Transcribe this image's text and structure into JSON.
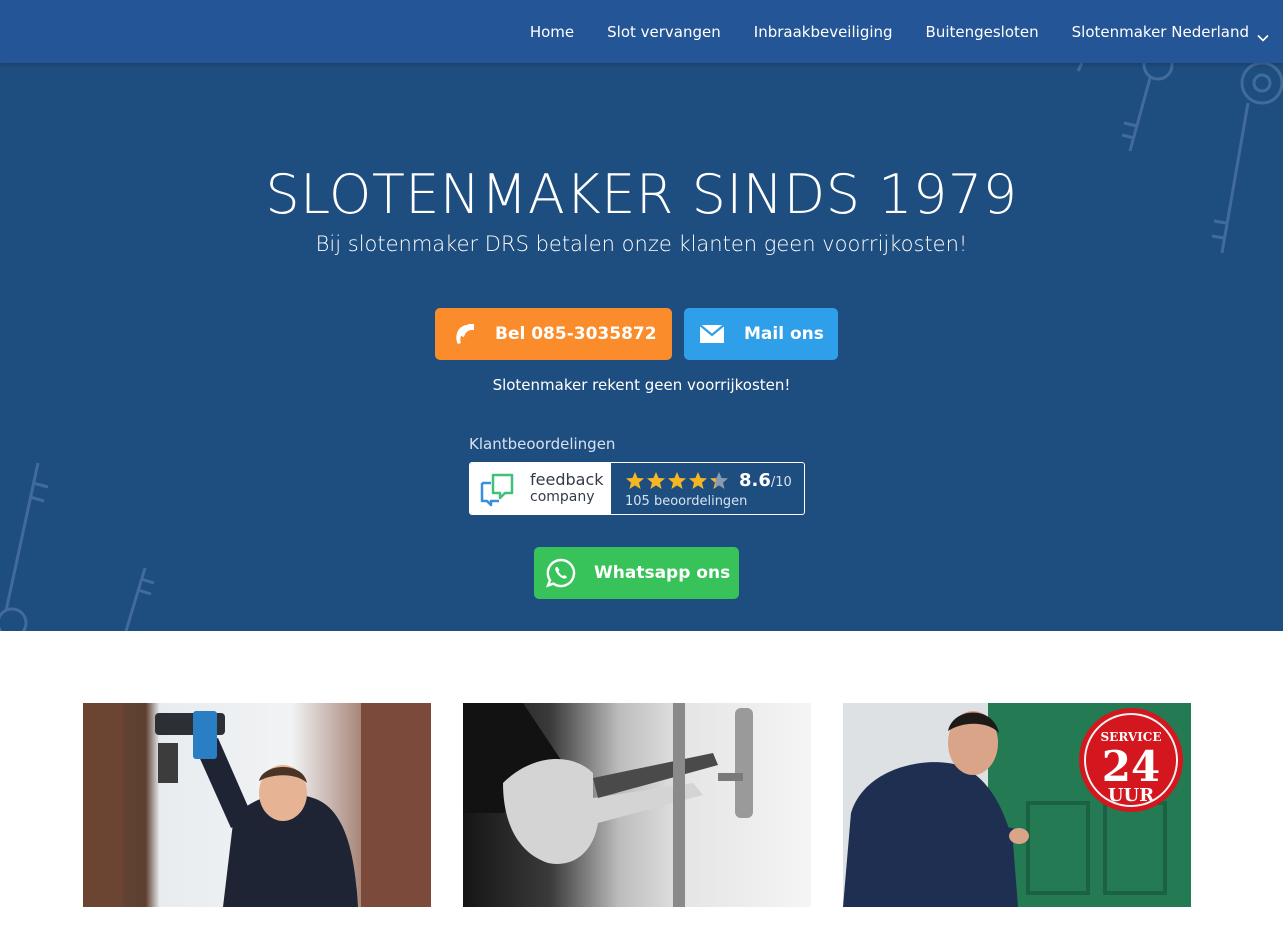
{
  "nav": {
    "items": [
      {
        "label": "Home"
      },
      {
        "label": "Slot vervangen"
      },
      {
        "label": "Inbraakbeveiliging"
      },
      {
        "label": "Buitengesloten"
      },
      {
        "label": "Slotenmaker Nederland"
      }
    ]
  },
  "hero": {
    "title": "SLOTENMAKER SINDS 1979",
    "subtitle": "Bij slotenmaker DRS betalen onze klanten geen voorrijkosten!",
    "call_label": "Bel 085-3035872",
    "mail_label": "Mail ons",
    "note": "Slotenmaker rekent geen voorrijkosten!",
    "whatsapp_label": "Whatsapp ons"
  },
  "reviews": {
    "label": "Klantbeoordelingen",
    "brand_line1": "feedback",
    "brand_line2": "company",
    "score": "8.6",
    "score_max": "/10",
    "rating_out_of_5": 4.3,
    "count_text": "105 beoordelingen"
  },
  "photos": {
    "badge_top": "SERVICE",
    "badge_number": "24",
    "badge_bottom": "UUR"
  },
  "colors": {
    "nav": "#245596",
    "hero": "#1e4d7f",
    "call": "#fa8c2b",
    "mail": "#2e9fe8",
    "whatsapp": "#38c35a",
    "star": "#f5b623"
  },
  "icons": [
    "chevron-down-icon",
    "phone-icon",
    "envelope-icon",
    "whatsapp-icon",
    "feedback-company-logo",
    "star-icon",
    "key-icon"
  ]
}
